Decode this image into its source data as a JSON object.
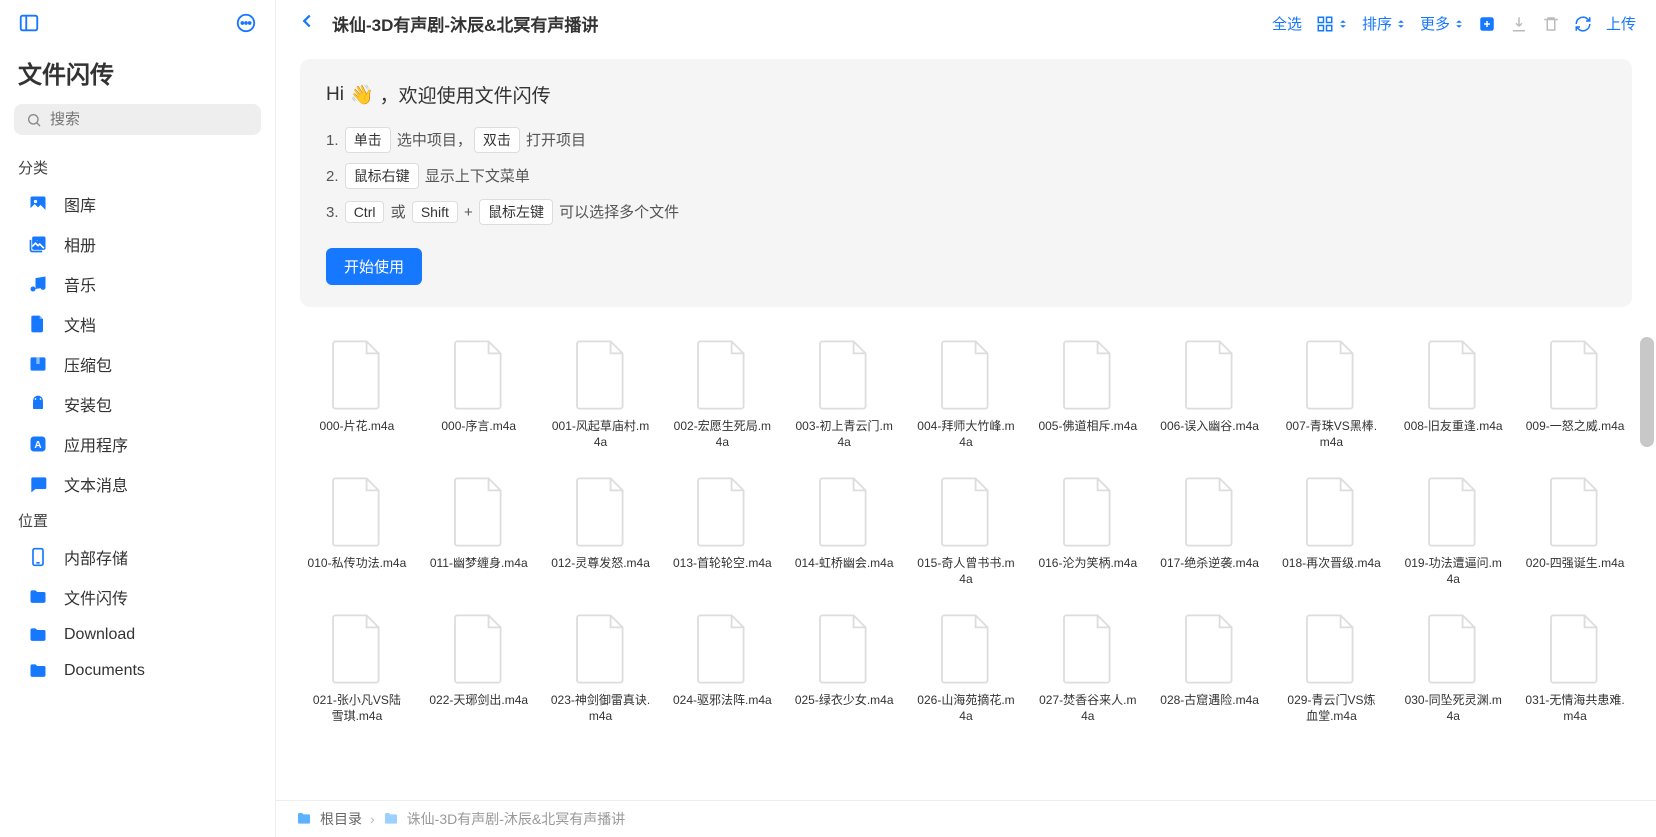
{
  "app": {
    "title": "文件闪传"
  },
  "search": {
    "placeholder": "搜索"
  },
  "sections": {
    "categories_label": "分类",
    "locations_label": "位置"
  },
  "categories": [
    {
      "id": "gallery",
      "label": "图库"
    },
    {
      "id": "album",
      "label": "相册"
    },
    {
      "id": "music",
      "label": "音乐"
    },
    {
      "id": "document",
      "label": "文档"
    },
    {
      "id": "archive",
      "label": "压缩包"
    },
    {
      "id": "apk",
      "label": "安装包"
    },
    {
      "id": "app",
      "label": "应用程序"
    },
    {
      "id": "message",
      "label": "文本消息"
    }
  ],
  "locations": [
    {
      "id": "internal",
      "label": "内部存储"
    },
    {
      "id": "flash",
      "label": "文件闪传"
    },
    {
      "id": "download",
      "label": "Download"
    },
    {
      "id": "documents",
      "label": "Documents"
    }
  ],
  "header": {
    "title": "诛仙-3D有声剧-沐辰&北冥有声播讲",
    "select_all": "全选",
    "sort": "排序",
    "more": "更多",
    "upload": "上传"
  },
  "welcome": {
    "greeting_prefix": "Hi ",
    "greeting_suffix": "，欢迎使用文件闪传",
    "tips": {
      "t1": {
        "k1": "单击",
        "txt1": "选中项目，",
        "k2": "双击",
        "txt2": "打开项目"
      },
      "t2": {
        "k1": "鼠标右键",
        "txt1": "显示上下文菜单"
      },
      "t3": {
        "k1": "Ctrl",
        "or": "或",
        "k2": "Shift",
        "plus": "+",
        "k3": "鼠标左键",
        "txt1": "可以选择多个文件"
      }
    },
    "start": "开始使用"
  },
  "files": [
    "000-片花.m4a",
    "000-序言.m4a",
    "001-风起草庙村.m4a",
    "002-宏愿生死局.m4a",
    "003-初上青云门.m4a",
    "004-拜师大竹峰.m4a",
    "005-佛道相斥.m4a",
    "006-误入幽谷.m4a",
    "007-青珠VS黑棒.m4a",
    "008-旧友重逢.m4a",
    "009-一怒之威.m4a",
    "010-私传功法.m4a",
    "011-幽梦缠身.m4a",
    "012-灵尊发怒.m4a",
    "013-首轮轮空.m4a",
    "014-虹桥幽会.m4a",
    "015-奇人曾书书.m4a",
    "016-沦为笑柄.m4a",
    "017-绝杀逆袭.m4a",
    "018-再次晋级.m4a",
    "019-功法遭逼问.m4a",
    "020-四强诞生.m4a",
    "021-张小凡VS陆雪琪.m4a",
    "022-天琊剑出.m4a",
    "023-神剑御雷真诀.m4a",
    "024-驱邪法阵.m4a",
    "025-绿衣少女.m4a",
    "026-山海苑摘花.m4a",
    "027-焚香谷来人.m4a",
    "028-古窟遇险.m4a",
    "029-青云门VS炼血堂.m4a",
    "030-同坠死灵渊.m4a",
    "031-无情海共患难.m4a"
  ],
  "breadcrumb": {
    "root": "根目录",
    "current": "诛仙-3D有声剧-沐辰&北冥有声播讲"
  }
}
